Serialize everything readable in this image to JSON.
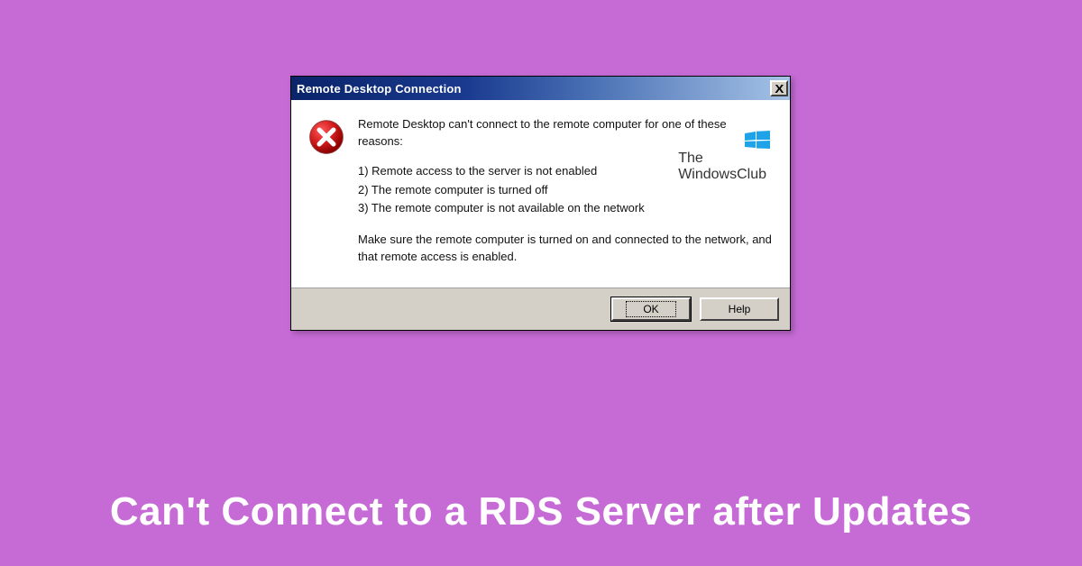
{
  "dialog": {
    "title": "Remote Desktop Connection",
    "close_x": "X",
    "intro": "Remote Desktop can't connect to the remote computer for one of these reasons:",
    "reason1": "1) Remote access to the server is not enabled",
    "reason2": "2) The remote computer is turned off",
    "reason3": "3) The remote computer is not available on the network",
    "advice": "Make sure the remote computer is turned on and connected to the network, and that remote access is enabled.",
    "ok_label": "OK",
    "help_label": "Help"
  },
  "watermark": {
    "line1": "The",
    "line2": "WindowsClub"
  },
  "caption": "Can't Connect to a RDS Server after Updates",
  "colors": {
    "stage_bg": "#c66bd6",
    "titlebar_start": "#0a246a",
    "titlebar_end": "#a6c3e6",
    "dialog_face": "#d4d0c8",
    "error_red": "#c8102e"
  }
}
